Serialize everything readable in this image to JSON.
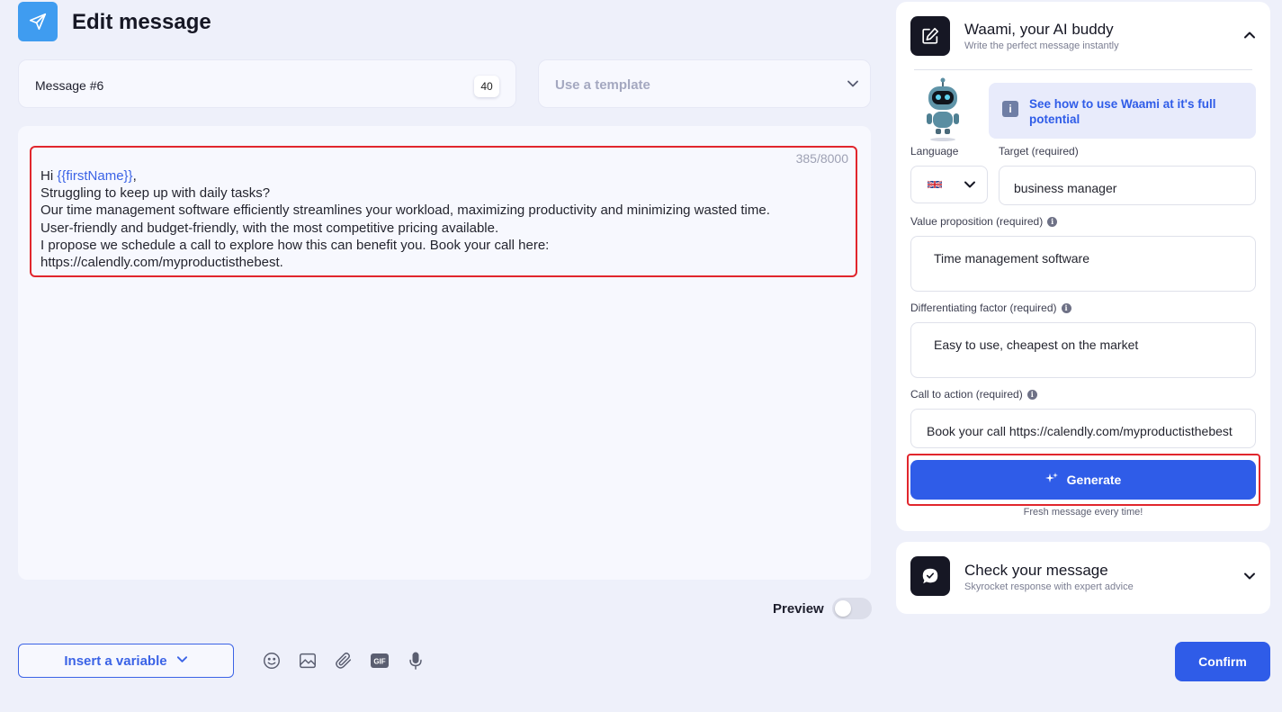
{
  "header": {
    "title": "Edit message",
    "icon": "send-icon"
  },
  "message": {
    "name": "Message #6",
    "name_count": "40"
  },
  "template": {
    "placeholder": "Use a template"
  },
  "editor": {
    "char_count": "385/8000",
    "greeting_prefix": "Hi ",
    "greeting_variable": "{{firstName}}",
    "greeting_suffix": ",",
    "lines": [
      "Struggling to keep up with daily tasks?",
      "Our time management software efficiently streamlines your workload, maximizing productivity and minimizing wasted time.",
      "User-friendly and budget-friendly, with the most competitive pricing available.",
      "I propose we schedule a call to explore how this can benefit you. Book your call here:",
      "https://calendly.com/myproductisthebest."
    ]
  },
  "preview": {
    "label": "Preview",
    "enabled": false
  },
  "toolbar": {
    "insert_variable": "Insert a variable",
    "tools": [
      "emoji-icon",
      "image-icon",
      "attachment-icon",
      "gif-icon",
      "microphone-icon"
    ],
    "gif_label": "GIF",
    "confirm": "Confirm"
  },
  "waami": {
    "title": "Waami, your AI buddy",
    "subtitle": "Write the perfect message instantly",
    "info_link": "See how to use Waami at it's full potential",
    "info_badge": "i",
    "language_label": "Language",
    "target_label": "Target (required)",
    "target_value": "business manager",
    "value_prop_label": "Value proposition (required)",
    "value_prop_value": "Time management software",
    "diff_label": "Differentiating factor (required)",
    "diff_value": "Easy to use, cheapest on the market",
    "cta_label": "Call to action (required)",
    "cta_value": "Book your call https://calendly.com/myproductisthebest",
    "generate": "Generate",
    "generate_note": "Fresh message every time!"
  },
  "check": {
    "title": "Check your message",
    "subtitle": "Skyrocket response with expert advice"
  },
  "colors": {
    "accent": "#2f5ce8",
    "highlight": "#e1262d",
    "background": "#eef0fa"
  }
}
